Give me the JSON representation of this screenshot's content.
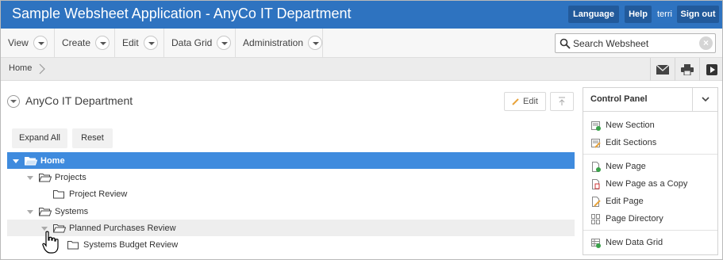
{
  "header": {
    "title": "Sample Websheet Application - AnyCo IT Department",
    "language_label": "Language",
    "help_label": "Help",
    "user": "terri",
    "signout_label": "Sign out"
  },
  "menu": {
    "items": [
      {
        "label": "View"
      },
      {
        "label": "Create"
      },
      {
        "label": "Edit"
      },
      {
        "label": "Data Grid"
      },
      {
        "label": "Administration"
      }
    ],
    "search_placeholder": "Search Websheet"
  },
  "breadcrumb": {
    "home": "Home"
  },
  "region": {
    "title": "AnyCo IT Department",
    "edit_label": "Edit",
    "expand_all_label": "Expand All",
    "reset_label": "Reset"
  },
  "tree": {
    "nodes": [
      {
        "label": "Home",
        "state": "selected"
      },
      {
        "label": "Projects"
      },
      {
        "label": "Project Review"
      },
      {
        "label": "Systems"
      },
      {
        "label": "Planned Purchases Review",
        "state": "hover"
      },
      {
        "label": "Systems Budget Review"
      }
    ]
  },
  "control_panel": {
    "title": "Control Panel",
    "items": [
      {
        "label": "New Section",
        "icon": "new-section-icon"
      },
      {
        "label": "Edit Sections",
        "icon": "edit-sections-icon"
      },
      {
        "label": "New Page",
        "icon": "new-page-icon"
      },
      {
        "label": "New Page as a Copy",
        "icon": "copy-page-icon"
      },
      {
        "label": "Edit Page",
        "icon": "edit-page-icon"
      },
      {
        "label": "Page Directory",
        "icon": "page-directory-icon"
      },
      {
        "label": "New Data Grid",
        "icon": "new-data-grid-icon"
      }
    ]
  },
  "colors": {
    "header_bg": "#2e73c0",
    "header_button_bg": "#225a9b",
    "selected_row_bg": "#3f8bde"
  }
}
